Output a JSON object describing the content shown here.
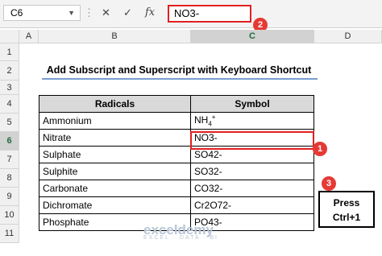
{
  "formula_bar": {
    "name_box": "C6",
    "cancel_icon": "✕",
    "enter_icon": "✓",
    "fx_label": "fx",
    "value": "NO3-"
  },
  "columns": [
    "A",
    "B",
    "C",
    "D"
  ],
  "rows": [
    "1",
    "2",
    "3",
    "4",
    "5",
    "6",
    "7",
    "8",
    "9",
    "10",
    "11"
  ],
  "sheet": {
    "title": "Add Subscript and Superscript with Keyboard Shortcut",
    "headers": [
      "Radicals",
      "Symbol"
    ],
    "ammonium": {
      "name": "Ammonium",
      "base": "NH",
      "sub": "4",
      "sup": "+"
    },
    "rows": [
      {
        "name": "Nitrate",
        "symbol": "NO3-"
      },
      {
        "name": "Sulphate",
        "symbol": "SO42-"
      },
      {
        "name": "Sulphite",
        "symbol": "SO32-"
      },
      {
        "name": "Carbonate",
        "symbol": "CO32-"
      },
      {
        "name": "Dichromate",
        "symbol": "Cr2O72-"
      },
      {
        "name": "Phosphate",
        "symbol": "PO43-"
      }
    ]
  },
  "annotations": {
    "badge_1": "1",
    "badge_2": "2",
    "badge_3": "3",
    "press_line1": "Press",
    "press_line2": "Ctrl+1"
  },
  "watermark": {
    "name": "exceldemy",
    "tagline": "EXCEL · DATA · BI"
  },
  "colors": {
    "highlight": "#e02020",
    "badge": "#e53935",
    "header_fill": "#d9d9d9",
    "title_underline": "#7a9cd0"
  }
}
